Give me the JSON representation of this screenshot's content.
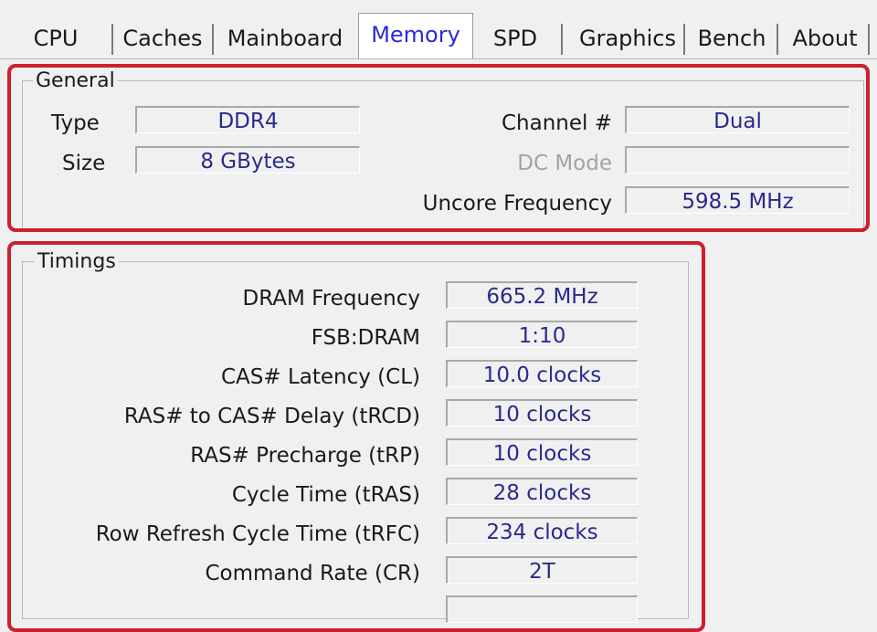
{
  "tabs": [
    {
      "label": "CPU"
    },
    {
      "label": "Caches"
    },
    {
      "label": "Mainboard"
    },
    {
      "label": "Memory"
    },
    {
      "label": "SPD"
    },
    {
      "label": "Graphics"
    },
    {
      "label": "Bench"
    },
    {
      "label": "About"
    }
  ],
  "active_tab": "Memory",
  "general": {
    "title": "General",
    "type_label": "Type",
    "type_value": "DDR4",
    "size_label": "Size",
    "size_value": "8 GBytes",
    "channel_label": "Channel #",
    "channel_value": "Dual",
    "dc_mode_label": "DC Mode",
    "dc_mode_value": "",
    "uncore_label": "Uncore Frequency",
    "uncore_value": "598.5 MHz"
  },
  "timings": {
    "title": "Timings",
    "rows": [
      {
        "label": "DRAM Frequency",
        "value": "665.2 MHz"
      },
      {
        "label": "FSB:DRAM",
        "value": "1:10"
      },
      {
        "label": "CAS# Latency (CL)",
        "value": "10.0 clocks"
      },
      {
        "label": "RAS# to CAS# Delay (tRCD)",
        "value": "10 clocks"
      },
      {
        "label": "RAS# Precharge (tRP)",
        "value": "10 clocks"
      },
      {
        "label": "Cycle Time (tRAS)",
        "value": "28 clocks"
      },
      {
        "label": "Row Refresh Cycle Time (tRFC)",
        "value": "234 clocks"
      },
      {
        "label": "Command Rate (CR)",
        "value": "2T"
      }
    ]
  },
  "colors": {
    "highlight": "#d01f2c",
    "value_text": "#2a2a8c",
    "active_tab_text": "#2b2bd6"
  }
}
